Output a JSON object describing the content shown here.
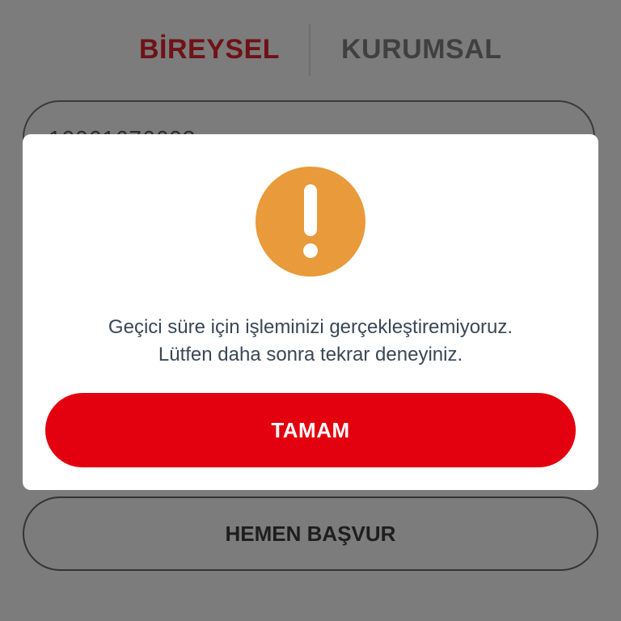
{
  "tabs": {
    "individual_label": "BİREYSEL",
    "corporate_label": "KURUMSAL",
    "active": "BİREYSEL"
  },
  "form": {
    "input_value": "10061676603"
  },
  "apply_button_label": "HEMEN BAŞVUR",
  "dialog": {
    "icon": "warning-exclamation-icon",
    "message_line1": "Geçici süre için işleminizi gerçekleştiremiyoruz.",
    "message_line2": "Lütfen daha sonra tekrar deneyiniz.",
    "ok_label": "TAMAM"
  },
  "colors": {
    "brand_red": "#e3000f",
    "active_tab_dimmed": "#6f1216",
    "warning_orange": "#e99a3a",
    "overlay": "#7c7c7c"
  }
}
